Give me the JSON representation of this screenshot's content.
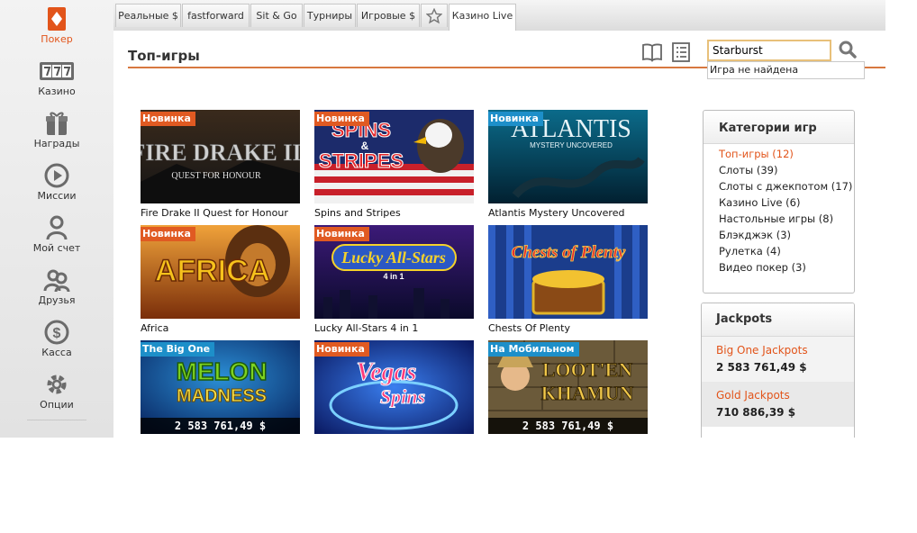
{
  "colors": {
    "accent": "#e2541a",
    "badge_new": "#e05a22",
    "badge_blue": "#1d8fc9"
  },
  "sidebar": {
    "items": [
      {
        "label": "Покер",
        "icon": "poker-diamond-icon",
        "active": true
      },
      {
        "label": "Казино",
        "icon": "slot-777-icon"
      },
      {
        "label": "Награды",
        "icon": "gift-icon"
      },
      {
        "label": "Миссии",
        "icon": "play-circle-icon"
      },
      {
        "label": "Мой счет",
        "icon": "user-icon"
      },
      {
        "label": "Друзья",
        "icon": "friends-icon"
      },
      {
        "label": "Касса",
        "icon": "dollar-icon"
      },
      {
        "label": "Опции",
        "icon": "gear-icon"
      }
    ]
  },
  "tabs": [
    {
      "label": "Реальные $"
    },
    {
      "label": "fastforward"
    },
    {
      "label": "Sit & Go"
    },
    {
      "label": "Турниры"
    },
    {
      "label": "Игровые $"
    },
    {
      "label": "",
      "icon": "star-icon"
    },
    {
      "label": "Казино Live",
      "active": true
    }
  ],
  "main": {
    "title": "Топ-игры",
    "search": {
      "value": "Starburst",
      "hint": "Игра не найдена"
    }
  },
  "games": [
    {
      "name": "Fire Drake II Quest for Honour",
      "badge": "Новинка"
    },
    {
      "name": "Spins and Stripes",
      "badge": "Новинка"
    },
    {
      "name": "Atlantis Mystery Uncovered",
      "badge": "Новинка"
    },
    {
      "name": "Africa",
      "badge": "Новинка"
    },
    {
      "name": "Lucky All-Stars 4 in 1",
      "badge": "Новинка"
    },
    {
      "name": "Chests Of Plenty",
      "badge": ""
    },
    {
      "name": "Melon Madness",
      "badge": "The Big One",
      "jackpot": "2 583 761,49 $"
    },
    {
      "name": "Vegas Spins",
      "badge": "Новинка"
    },
    {
      "name": "Loot'en Khamun",
      "badge": "На Мобильном",
      "jackpot": "2 583 761,49 $"
    }
  ],
  "art_text": {
    "firedrake_title": "FIRE DRAKE II",
    "firedrake_sub": "QUEST FOR HONOUR",
    "spins_title": "SPINS",
    "spins_amp": "&",
    "spins_stripes": "STRIPES",
    "atlantis_title": "ATLANTIS",
    "atlantis_sub": "MYSTERY UNCOVERED",
    "africa_title": "AFRICA",
    "lucky_title": "Lucky All-Stars",
    "lucky_sub": "4 in 1",
    "chests_title": "Chests of Plenty",
    "melon_title": "MELON",
    "melon_sub": "MADNESS",
    "vegas_title": "Vegas",
    "vegas_sub": "Spins",
    "loot_title": "LOOT'EN",
    "loot_sub": "KHAMUN"
  },
  "categories": {
    "title": "Категории игр",
    "items": [
      {
        "label": "Топ-игры (12)",
        "active": true
      },
      {
        "label": "Слоты (39)"
      },
      {
        "label": "Слоты с джекпотом (17)"
      },
      {
        "label": "Казино Live (6)"
      },
      {
        "label": "Настольные игры (8)"
      },
      {
        "label": "Блэкджэк (3)"
      },
      {
        "label": "Рулетка (4)"
      },
      {
        "label": "Видео покер (3)"
      }
    ]
  },
  "jackpots": {
    "title": "Jackpots",
    "items": [
      {
        "name": "Big One Jackpots",
        "value": "2 583 761,49 $"
      },
      {
        "name": "Gold Jackpots",
        "value": "710 886,39 $"
      }
    ]
  }
}
